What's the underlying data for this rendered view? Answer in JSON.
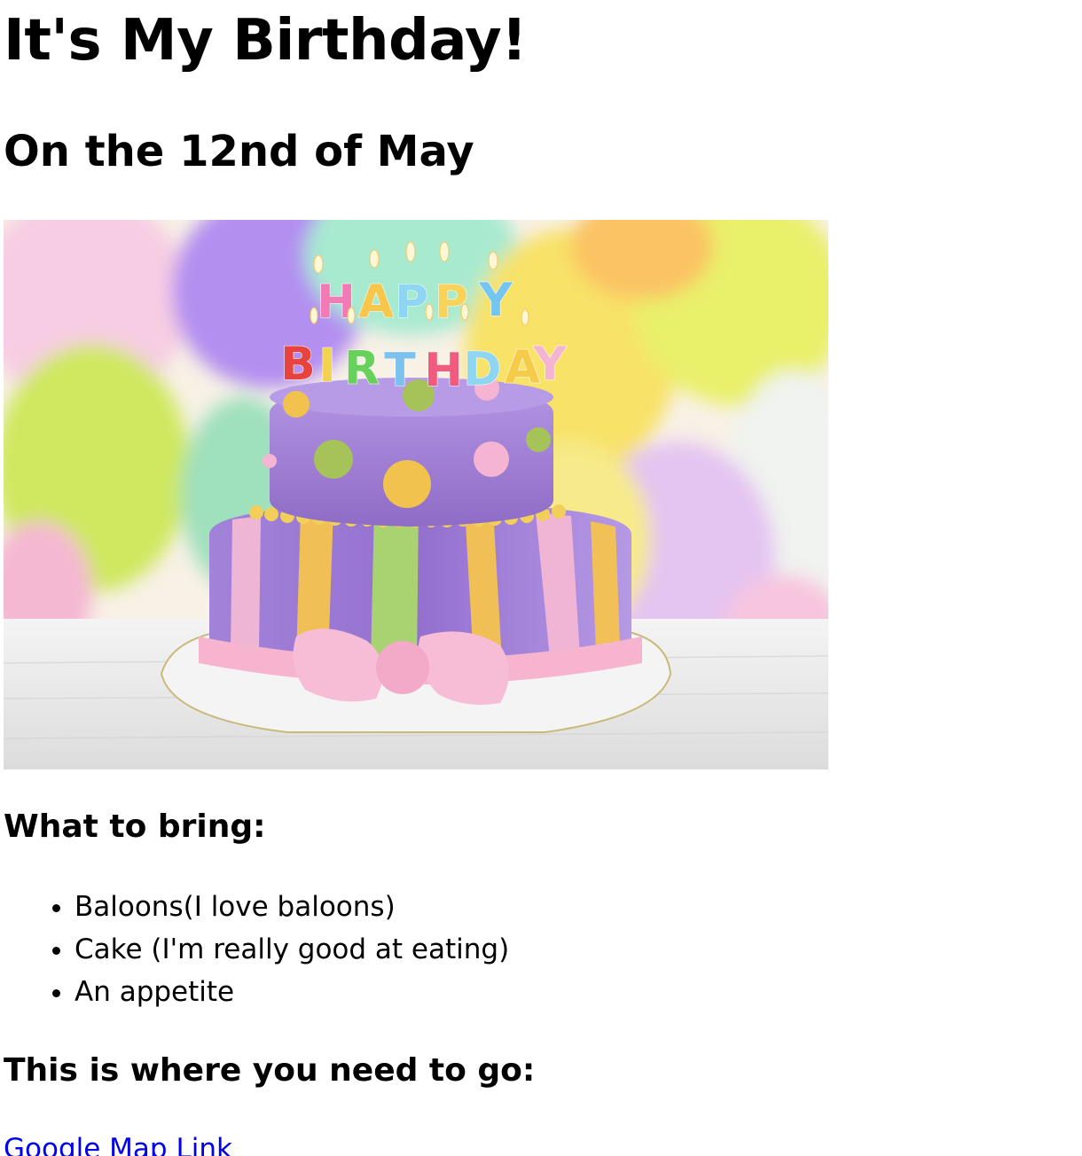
{
  "title": "It's My Birthday!",
  "subtitle": "On the 12nd of May",
  "photo": {
    "icon": "birthday-cake-photo",
    "cake_text_top": "HAPPY",
    "cake_text_bottom": "BIRTHDAY",
    "colors": {
      "background_balloons": [
        "#f7c6e2",
        "#b891ee",
        "#cfe65f",
        "#f6e66a",
        "#fbc86c",
        "#9de3c4"
      ],
      "cake_purple": "#9b7bd0",
      "cake_stripe_yellow": "#f5c451",
      "cake_stripe_green": "#a9d86a",
      "cake_stripe_pink": "#f4b8d4",
      "ribbon_pink": "#f6b4cf",
      "table_white": "#eeeeee"
    }
  },
  "bring": {
    "heading": "What to bring:",
    "items": [
      "Baloons(I love baloons)",
      "Cake (I'm really good at eating)",
      "An appetite"
    ]
  },
  "where": {
    "heading": "This is where you need to go:",
    "link_text": "Google Map Link",
    "link_color": "#0000ee"
  }
}
